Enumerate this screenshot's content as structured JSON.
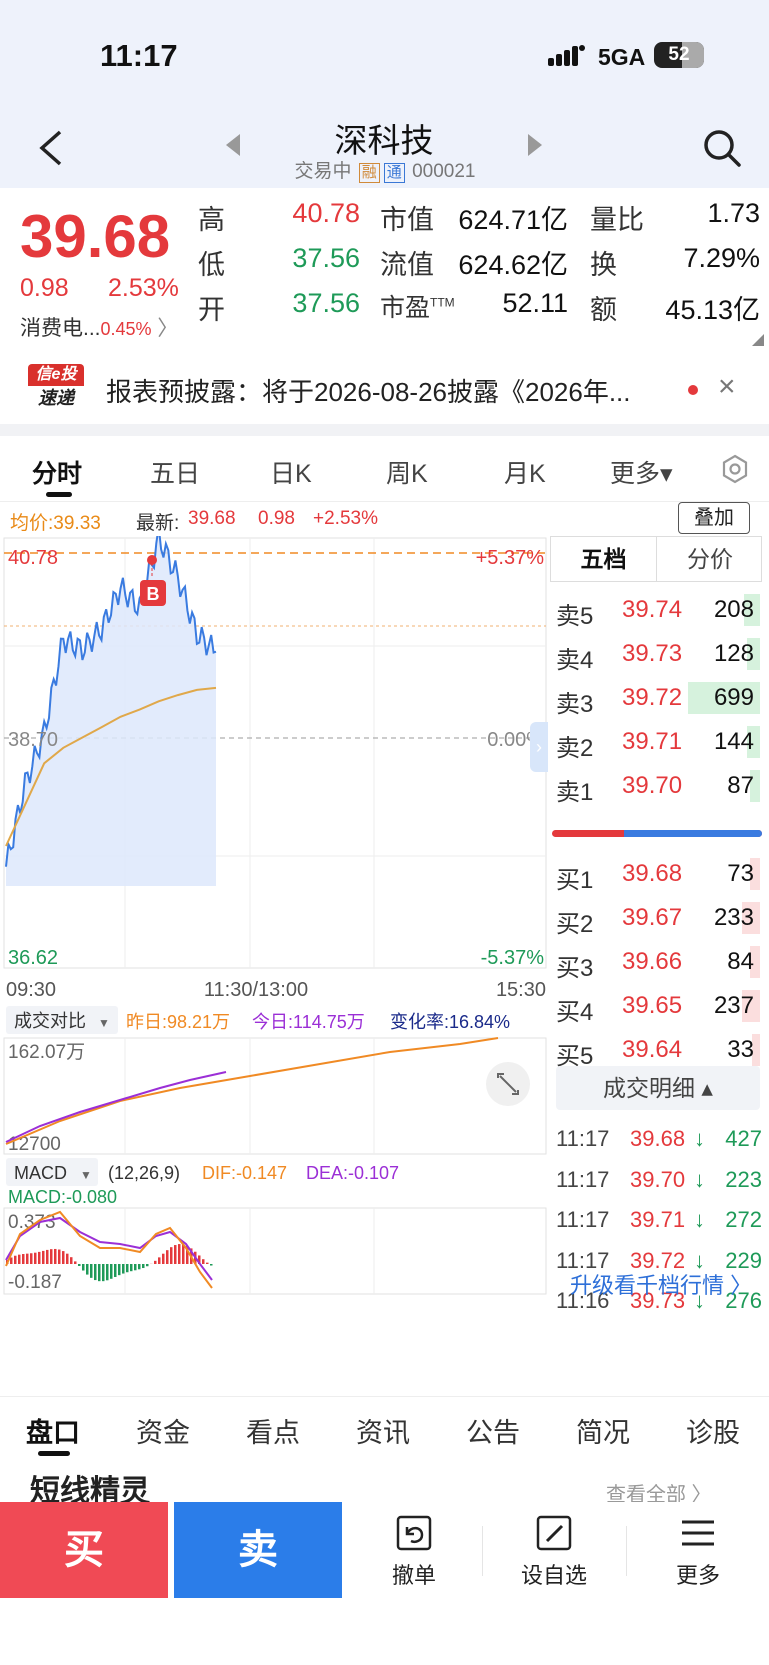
{
  "status": {
    "time": "11:17",
    "network": "5GA",
    "battery": "52"
  },
  "header": {
    "name": "深科技",
    "status_text": "交易中",
    "tag1": "融",
    "tag2": "通",
    "code": "000021"
  },
  "quote": {
    "price": "39.68",
    "change": "0.98",
    "change_pct": "2.53%",
    "sector": "消费电...",
    "sector_pct": "0.45%",
    "stats": [
      {
        "label": "高",
        "value": "40.78",
        "color": "red"
      },
      {
        "label": "低",
        "value": "37.56",
        "color": "green"
      },
      {
        "label": "开",
        "value": "37.56",
        "color": "green"
      }
    ],
    "stats2": [
      {
        "label": "市值",
        "value": "624.71亿"
      },
      {
        "label": "流值",
        "value": "624.62亿"
      },
      {
        "label": "市盈TTM",
        "value": "52.11"
      }
    ],
    "stats3": [
      {
        "label": "量比",
        "value": "1.73"
      },
      {
        "label": "换",
        "value": "7.29%"
      },
      {
        "label": "额",
        "value": "45.13亿"
      }
    ]
  },
  "notice": {
    "logo_top": "信e投",
    "logo_bottom": "速递",
    "text": "报表预披露：将于2026-08-26披露《2026年...",
    "close": "×"
  },
  "period_tabs": [
    "分时",
    "五日",
    "日K",
    "周K",
    "月K",
    "更多▾"
  ],
  "infoline": {
    "avg_label": "均价:",
    "avg_value": "39.33",
    "latest_label": "最新:",
    "latest_value": "39.68",
    "latest_change": "0.98",
    "latest_pct": "+2.53%",
    "overlay_btn": "叠加"
  },
  "chart_labels": {
    "high_price": "40.78",
    "high_pct": "+5.37%",
    "mid_price": "38.70",
    "mid_pct": "0.00%",
    "low_price": "36.62",
    "low_pct": "-5.37%",
    "t_open": "09:30",
    "t_mid": "11:30/13:00",
    "t_close": "15:30",
    "buy_marker": "B"
  },
  "colors": {
    "up": "#e4393c",
    "down": "#1e9a58",
    "price_line": "#3a7be0",
    "avg_line": "#e0a84a",
    "vol_today": "#9b2fd6",
    "vol_yesterday": "#f08a24"
  },
  "chart_data": {
    "type": "line",
    "x": [
      "09:30",
      "09:40",
      "09:50",
      "10:00",
      "10:10",
      "10:20",
      "10:30",
      "10:40",
      "10:50",
      "11:00",
      "11:10",
      "11:17"
    ],
    "series": [
      {
        "values": [
          37.6,
          38.4,
          38.9,
          39.8,
          39.7,
          39.9,
          40.3,
          40.1,
          40.78,
          40.4,
          39.85,
          39.68
        ]
      },
      {
        "values": [
          37.8,
          38.2,
          38.6,
          38.75,
          38.85,
          38.95,
          39.05,
          39.12,
          39.2,
          39.26,
          39.31,
          39.33
        ]
      }
    ],
    "ylim": [
      36.62,
      40.78
    ]
  },
  "volume_compare": {
    "dropdown": "成交对比",
    "yesterday_label": "昨日:",
    "yesterday_value": "98.21万",
    "today_label": "今日:",
    "today_value": "114.75万",
    "rate_label": "变化率:",
    "rate_value": "16.84%",
    "top_label": "162.07万",
    "bottom_label": "12700"
  },
  "macd": {
    "dropdown": "MACD",
    "params": "(12,26,9)",
    "dif": "DIF:-0.147",
    "dea": "DEA:-0.107",
    "macd": "MACD:-0.080",
    "top": "0.373",
    "bottom": "-0.187"
  },
  "orderbook": {
    "tab1": "五档",
    "tab2": "分价",
    "sells": [
      {
        "label": "卖5",
        "price": "39.74",
        "vol": "208",
        "ratio": 0.12
      },
      {
        "label": "卖4",
        "price": "39.73",
        "vol": "128",
        "ratio": 0.1
      },
      {
        "label": "卖3",
        "price": "39.72",
        "vol": "699",
        "ratio": 0.55
      },
      {
        "label": "卖2",
        "price": "39.71",
        "vol": "144",
        "ratio": 0.1
      },
      {
        "label": "卖1",
        "price": "39.70",
        "vol": "87",
        "ratio": 0.08
      }
    ],
    "buys": [
      {
        "label": "买1",
        "price": "39.68",
        "vol": "73",
        "ratio": 0.08
      },
      {
        "label": "买2",
        "price": "39.67",
        "vol": "233",
        "ratio": 0.14
      },
      {
        "label": "买3",
        "price": "39.66",
        "vol": "84",
        "ratio": 0.08
      },
      {
        "label": "买4",
        "price": "39.65",
        "vol": "237",
        "ratio": 0.14
      },
      {
        "label": "买5",
        "price": "39.64",
        "vol": "33",
        "ratio": 0.06
      }
    ],
    "detail_btn": "成交明细 ▴",
    "trades": [
      {
        "time": "11:17",
        "price": "39.68",
        "dir": "↓",
        "vol": "427"
      },
      {
        "time": "11:17",
        "price": "39.70",
        "dir": "↓",
        "vol": "223"
      },
      {
        "time": "11:17",
        "price": "39.71",
        "dir": "↓",
        "vol": "272"
      },
      {
        "time": "11:17",
        "price": "39.72",
        "dir": "↓",
        "vol": "229"
      },
      {
        "time": "11:16",
        "price": "39.73",
        "dir": "↓",
        "vol": "276"
      }
    ],
    "upgrade": "升级看千档行情 〉"
  },
  "bottom_tabs": [
    "盘口",
    "资金",
    "看点",
    "资讯",
    "公告",
    "简况",
    "诊股"
  ],
  "section": {
    "title": "短线精灵",
    "more": "查看全部 〉"
  },
  "actions": {
    "buy": "买",
    "sell": "卖",
    "cancel": "撤单",
    "watch": "设自选",
    "more": "更多"
  }
}
